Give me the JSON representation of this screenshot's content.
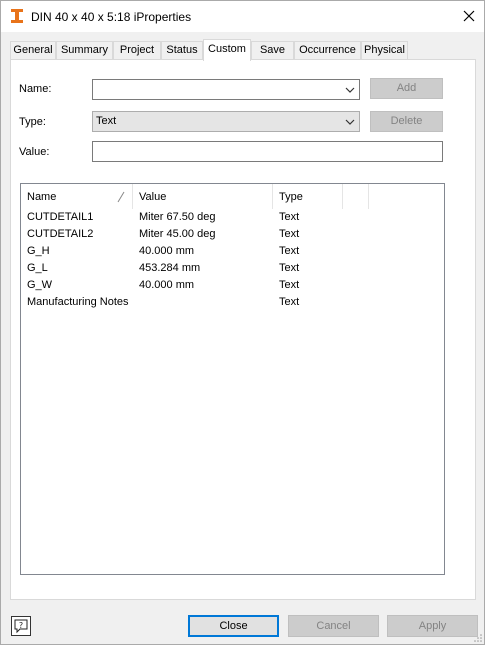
{
  "window": {
    "title": "DIN 40 x 40 x 5:18 iProperties",
    "app_icon": "inventor-part-icon",
    "close_icon": "close-icon"
  },
  "tabs": [
    {
      "label": "General",
      "active": false
    },
    {
      "label": "Summary",
      "active": false
    },
    {
      "label": "Project",
      "active": false
    },
    {
      "label": "Status",
      "active": false
    },
    {
      "label": "Custom",
      "active": true
    },
    {
      "label": "Save",
      "active": false
    },
    {
      "label": "Occurrence",
      "active": false
    },
    {
      "label": "Physical",
      "active": false
    }
  ],
  "form": {
    "name_label": "Name:",
    "name_value": "",
    "type_label": "Type:",
    "type_value": "Text",
    "value_label": "Value:",
    "value_value": "",
    "add_label": "Add",
    "delete_label": "Delete"
  },
  "table": {
    "columns": [
      "Name",
      "Value",
      "Type"
    ],
    "rows": [
      {
        "name": "CUTDETAIL1",
        "value": "Miter 67.50 deg",
        "type": "Text"
      },
      {
        "name": "CUTDETAIL2",
        "value": "Miter 45.00 deg",
        "type": "Text"
      },
      {
        "name": "G_H",
        "value": "40.000 mm",
        "type": "Text"
      },
      {
        "name": "G_L",
        "value": "453.284 mm",
        "type": "Text"
      },
      {
        "name": "G_W",
        "value": "40.000 mm",
        "type": "Text"
      },
      {
        "name": "Manufacturing Notes",
        "value": "",
        "type": "Text"
      }
    ]
  },
  "footer": {
    "close_label": "Close",
    "cancel_label": "Cancel",
    "apply_label": "Apply"
  },
  "colors": {
    "accent": "#0078d7",
    "icon_orange": "#e8731a"
  }
}
